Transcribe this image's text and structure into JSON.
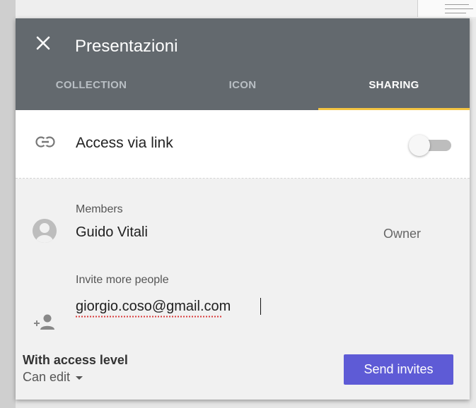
{
  "dialog": {
    "title": "Presentazioni",
    "close_icon": "close-icon"
  },
  "tabs": [
    {
      "label": "COLLECTION",
      "active": false
    },
    {
      "label": "ICON",
      "active": false
    },
    {
      "label": "SHARING",
      "active": true
    }
  ],
  "access_link": {
    "icon": "link-icon",
    "label": "Access via link",
    "enabled": false
  },
  "members": {
    "label": "Members",
    "items": [
      {
        "name": "Guido Vitali",
        "role": "Owner",
        "avatar": "avatar-icon"
      }
    ]
  },
  "invite": {
    "label": "Invite more people",
    "icon": "add-person-icon",
    "value": "giorgio.coso@gmail.com"
  },
  "access_level": {
    "title": "With access level",
    "value": "Can edit"
  },
  "send_button": {
    "label": "Send invites"
  },
  "colors": {
    "header": "#63696e",
    "tab_indicator": "#f4c542",
    "send_button": "#5e5bd6"
  }
}
